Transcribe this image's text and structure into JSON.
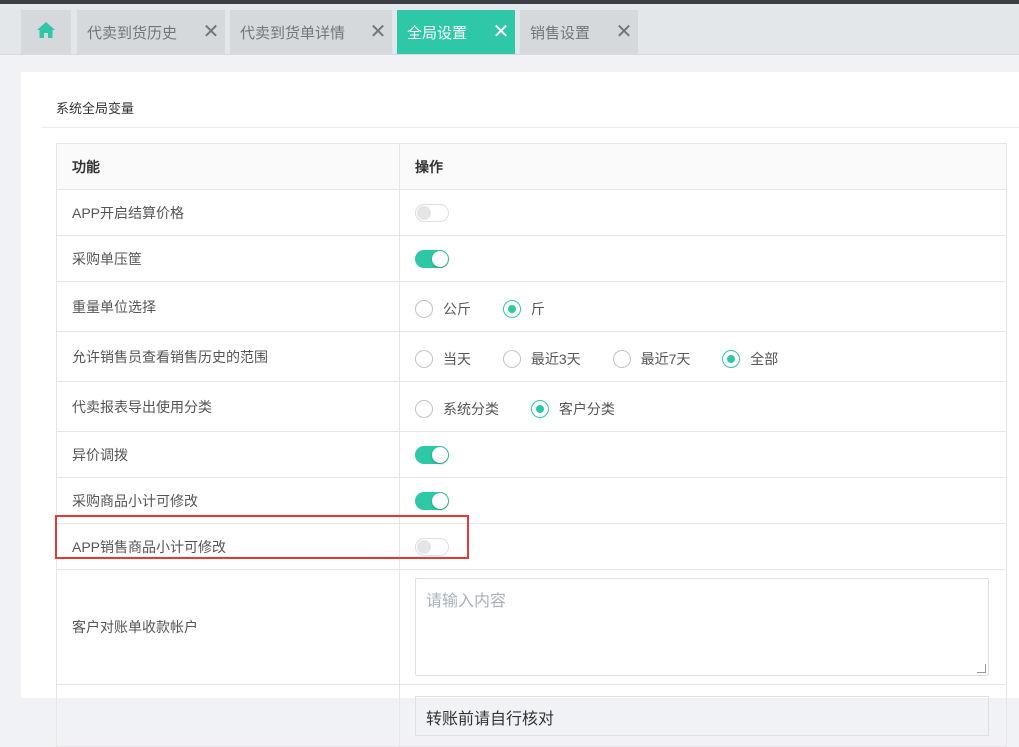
{
  "tabs": [
    {
      "label": "代卖到货历史",
      "close": "✕"
    },
    {
      "label": "代卖到货单详情",
      "close": "✕"
    },
    {
      "label": "全局设置",
      "close": "✕",
      "active": true
    },
    {
      "label": "销售设置",
      "close": "✕"
    }
  ],
  "home_icon": "home-icon",
  "section": {
    "title": "系统全局变量"
  },
  "table": {
    "headers": [
      "功能",
      "操作"
    ],
    "rows": [
      {
        "label": "APP开启结算价格",
        "type": "switch",
        "on": false
      },
      {
        "label": "采购单压筐",
        "type": "switch",
        "on": true
      },
      {
        "label": "重量单位选择",
        "type": "radio",
        "options": [
          "公斤",
          "斤"
        ],
        "selected": "斤"
      },
      {
        "label": "允许销售员查看销售历史的范围",
        "type": "radio",
        "options": [
          "当天",
          "最近3天",
          "最近7天",
          "全部"
        ],
        "selected": "全部"
      },
      {
        "label": "代卖报表导出使用分类",
        "type": "radio",
        "options": [
          "系统分类",
          "客户分类"
        ],
        "selected": "客户分类"
      },
      {
        "label": "异价调拨",
        "type": "switch",
        "on": true
      },
      {
        "label": "采购商品小计可修改",
        "type": "switch",
        "on": true
      },
      {
        "label": "APP销售商品小计可修改",
        "type": "switch",
        "on": false
      },
      {
        "label": "客户对账单收款帐户",
        "type": "textarea",
        "placeholder": "请输入内容"
      },
      {
        "label": "",
        "type": "textarea_partial",
        "value": "转账前请自行核对"
      }
    ]
  },
  "colors": {
    "accent": "#2ec7a7",
    "highlight": "#e53935"
  }
}
